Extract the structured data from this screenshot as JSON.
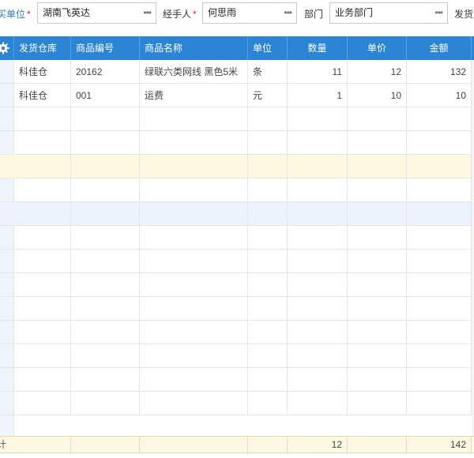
{
  "form": {
    "buyer": {
      "label": "买单位",
      "required": "*",
      "value": "湖南飞英达"
    },
    "handler": {
      "label": "经手人",
      "required": "*",
      "value": "何思雨"
    },
    "department": {
      "label": "部门",
      "value": "业务部门"
    },
    "shipper": {
      "label": "发货"
    },
    "more_glyph": "•••"
  },
  "table": {
    "columns": [
      "发货仓库",
      "商品编号",
      "商品名称",
      "单位",
      "数量",
      "单价",
      "金额"
    ],
    "rows": [
      {
        "warehouse": "科佳仓",
        "code": "20162",
        "name": "绿联六类网线 黑色5米",
        "unit": "条",
        "qty": "11",
        "price": "12",
        "amount": "132"
      },
      {
        "warehouse": "科佳仓",
        "code": "001",
        "name": "运费",
        "unit": "元",
        "qty": "1",
        "price": "10",
        "amount": "10"
      }
    ],
    "footer": {
      "label": "计",
      "qty_total": "12",
      "amount_total": "142"
    }
  },
  "icons": {
    "settings": "gear-icon",
    "more": "ellipsis-icon"
  },
  "colors": {
    "header": "#2b85d4",
    "highlight_row": "#fff8e1",
    "selected_row": "#edf3fc",
    "footer": "#fdf8e1",
    "label_blue": "#2b7cd3",
    "required": "#e02020"
  }
}
